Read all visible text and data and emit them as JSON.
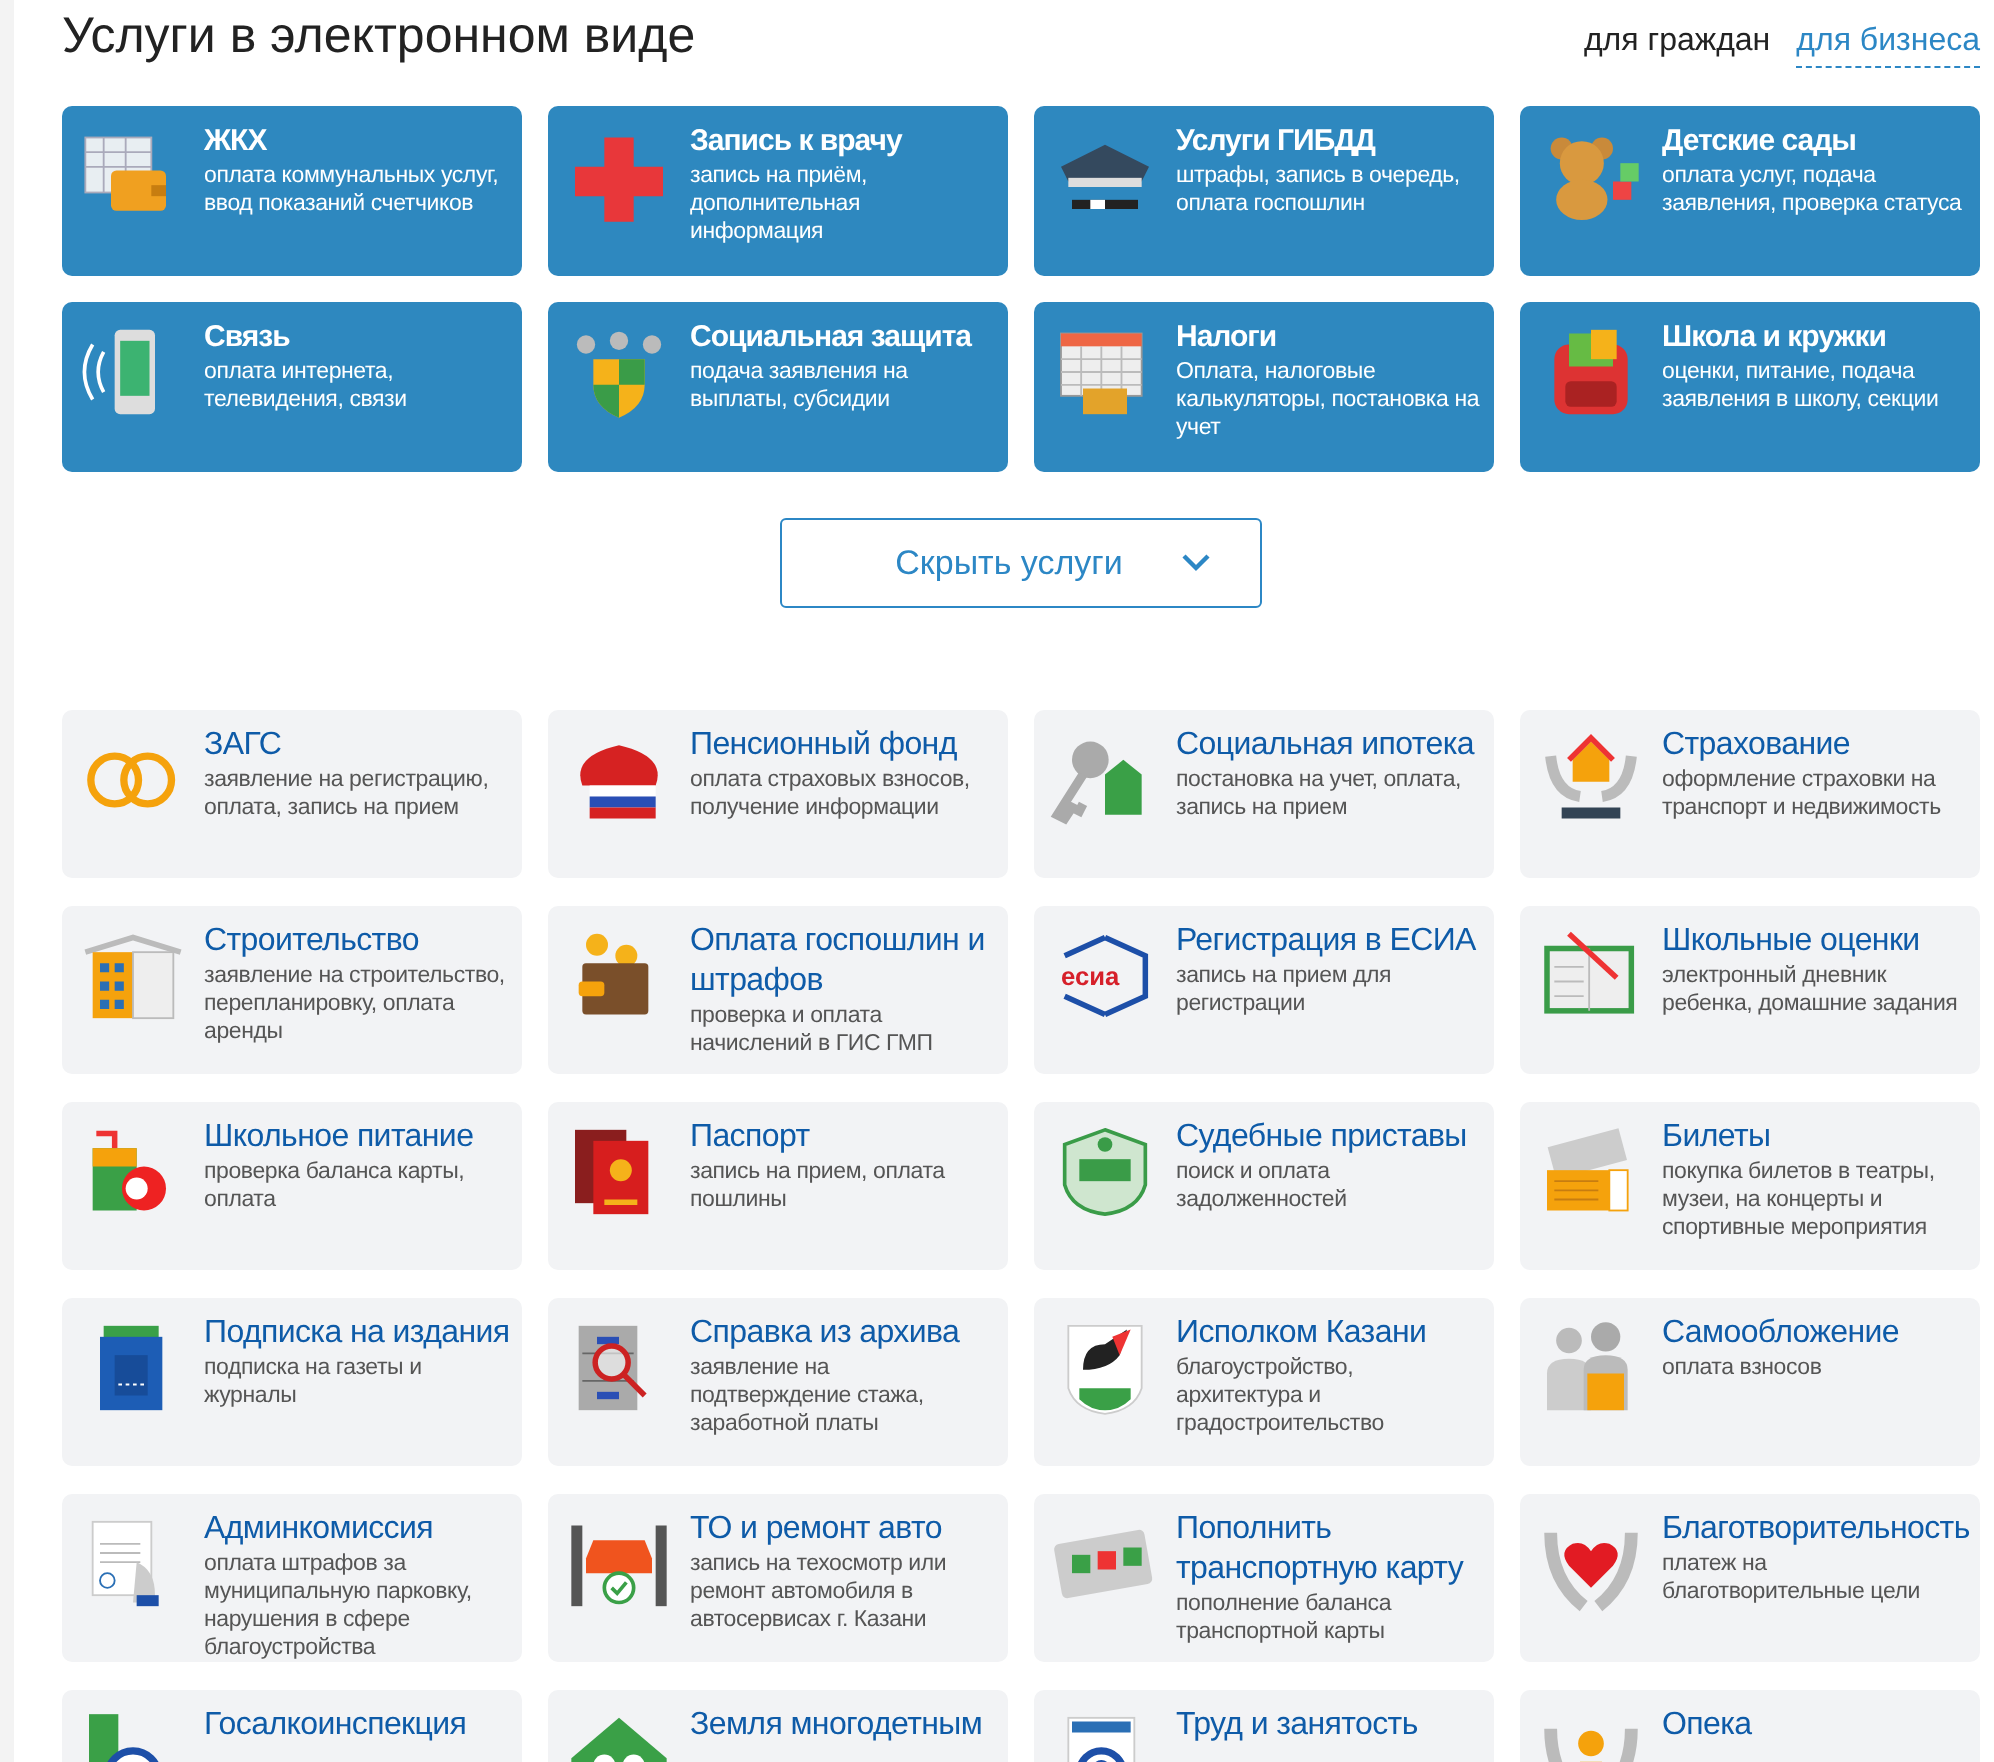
{
  "header": {
    "title": "Услуги в электронном виде",
    "audience_tabs": [
      {
        "label": "для граждан",
        "selected": true
      },
      {
        "label": "для бизнеса",
        "selected": false
      }
    ]
  },
  "featured_services": [
    {
      "title": "ЖКХ",
      "description": "оплата коммунальных услуг, ввод показаний счетчиков"
    },
    {
      "title": "Запись к врачу",
      "description": "запись на приём, дополнительная информация"
    },
    {
      "title": "Услуги ГИБДД",
      "description": "штрафы, запись в очередь, оплата госпошлин"
    },
    {
      "title": "Детские сады",
      "description": "оплата услуг, подача заявления, проверка статуса"
    },
    {
      "title": "Связь",
      "description": "оплата интернета, телевидения, связи"
    },
    {
      "title": "Социальная защита",
      "description": "подача заявления на выплаты, субсидии"
    },
    {
      "title": "Налоги",
      "description": "Оплата, налоговые калькуляторы, постановка на учет"
    },
    {
      "title": "Школа и кружки",
      "description": "оценки, питание, подача заявления в школу, секции"
    }
  ],
  "toggle_button": {
    "label": "Скрыть услуги",
    "expanded": true
  },
  "services": [
    {
      "title": "ЗАГС",
      "description": "заявление на регистрацию, оплата, запись на прием"
    },
    {
      "title": "Пенсионный фонд",
      "description": "оплата страховых взносов, получение информации"
    },
    {
      "title": "Социальная ипотека",
      "description": "постановка на учет, оплата, запись на прием"
    },
    {
      "title": "Страхование",
      "description": "оформление страховки на транспорт и недвижимость"
    },
    {
      "title": "Строительство",
      "description": "заявление на строительство, перепланировку, оплата аренды"
    },
    {
      "title": "Оплата госпошлин и штрафов",
      "description": "проверка и оплата начислений в ГИС ГМП"
    },
    {
      "title": "Регистрация в ЕСИА",
      "description": "запись на прием для регистрации",
      "logo_text": "есиа"
    },
    {
      "title": "Школьные оценки",
      "description": "электронный дневник ребенка, домашние задания"
    },
    {
      "title": "Школьное питание",
      "description": "проверка баланса карты, оплата"
    },
    {
      "title": "Паспорт",
      "description": "запись на прием, оплата пошлины"
    },
    {
      "title": "Судебные приставы",
      "description": "поиск и оплата задолженностей"
    },
    {
      "title": "Билеты",
      "description": "покупка билетов в театры, музеи, на концерты и спортивные мероприятия"
    },
    {
      "title": "Подписка на издания",
      "description": "подписка на газеты и журналы"
    },
    {
      "title": "Справка из архива",
      "description": "заявление на подтверждение стажа, заработной платы"
    },
    {
      "title": "Исполком Казани",
      "description": "благоустройство, архитектура и градостроительство"
    },
    {
      "title": "Самообложение",
      "description": "оплата взносов"
    },
    {
      "title": "Админкомиссия",
      "description": "оплата штрафов за муниципальную парковку, нарушения в сфере благоустройства"
    },
    {
      "title": "ТО и ремонт авто",
      "description": "запись на техосмотр или ремонт автомобиля в автосервисах г. Казани"
    },
    {
      "title": "Пополнить транспортную карту",
      "description": "пополнение баланса транспортной карты"
    },
    {
      "title": "Благотворительность",
      "description": "платеж на благотворительные цели"
    },
    {
      "title": "Госалкоинспекция"
    },
    {
      "title": "Земля многодетным"
    },
    {
      "title": "Труд и занятость"
    },
    {
      "title": "Опека"
    }
  ]
}
